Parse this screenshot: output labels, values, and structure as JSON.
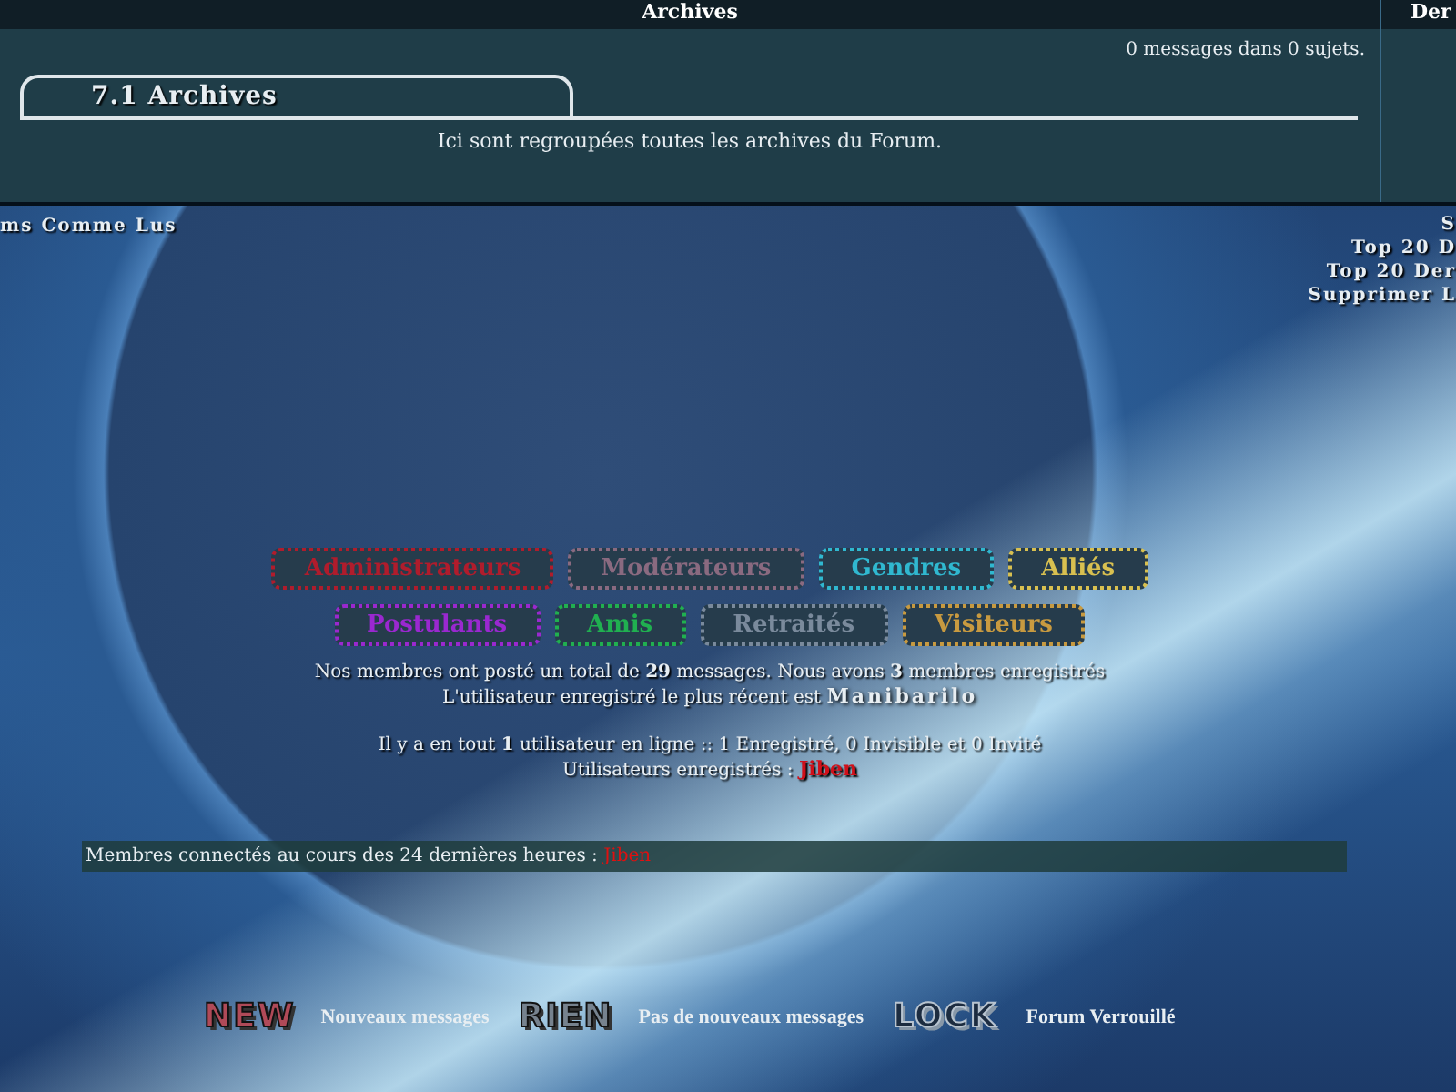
{
  "category_header": {
    "title": "Archives",
    "column_2": "Der"
  },
  "forum": {
    "stats": "0 messages dans 0 sujets.",
    "title": "7.1 Archives",
    "description": "Ici sont regroupées toutes les archives du Forum."
  },
  "left_link": "ms Comme Lus",
  "right_links": [
    "S",
    "Top 20 D",
    "Top 20 Der",
    "Supprimer L"
  ],
  "group_rows": [
    [
      {
        "label": "Administrateurs",
        "color": "#b01c2c"
      },
      {
        "label": "Modérateurs",
        "color": "#8a6a80"
      },
      {
        "label": "Gendres",
        "color": "#30b8d0"
      },
      {
        "label": "Alliés",
        "color": "#d8c050"
      }
    ],
    [
      {
        "label": "Postulants",
        "color": "#9a28d0"
      },
      {
        "label": "Amis",
        "color": "#20b050"
      },
      {
        "label": "Retraités",
        "color": "#7a8a9c"
      },
      {
        "label": "Visiteurs",
        "color": "#c89a40"
      }
    ]
  ],
  "stats": [
    {
      "text": "Nos membres ont posté un total de **29** messages. Nous avons **3** membres enregistrés"
    },
    {
      "text": "L'utilisateur enregistré le plus récent est ",
      "user": "Manibarilo",
      "kind": "shadow"
    },
    {
      "text": "Il y a en tout **1** utilisateur en ligne :: 1 Enregistré, 0 Invisible et 0 Invité",
      "kind": "gap"
    },
    {
      "text": "Utilisateurs enregistrés : ",
      "user": "Jiben",
      "kind": "red"
    }
  ],
  "last_24h": {
    "text": "Membres connectés au cours des 24 dernières heures : ",
    "user": "Jiben"
  },
  "legend": [
    {
      "badge": "NEW",
      "label": "Nouveaux messages",
      "color": "#b04a58"
    },
    {
      "badge": "RIEN",
      "label": "Pas de nouveaux messages",
      "color": "#76828e"
    },
    {
      "badge": "LOCK",
      "label": "Forum Verrouillé",
      "color": "#1c2c40"
    }
  ]
}
